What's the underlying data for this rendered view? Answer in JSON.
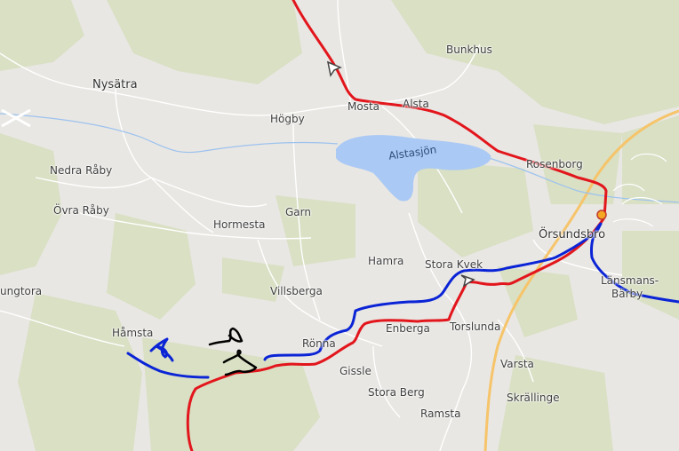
{
  "map": {
    "colors": {
      "background": "#e9e7e3",
      "forest": "#d3deba",
      "water": "#aac9f4",
      "stream": "#9cc2ef",
      "road_minor": "#ffffff",
      "road_major": "#f6c46a",
      "route_red": "#e2161c",
      "route_blue": "#0a24d6",
      "route_black": "#000000"
    },
    "labels": {
      "nysatra": "Nysätra",
      "hogby": "Högby",
      "mosta": "Mosta",
      "alsta": "Alsta",
      "bunkhus": "Bunkhus",
      "alstasjon": "Alstasjön",
      "rosenborg": "Rosenborg",
      "nedra_raby": "Nedra Råby",
      "ovra_raby": "Övra Råby",
      "hormesta": "Hormesta",
      "garn": "Garn",
      "orsundsbro": "Örsundsbro",
      "hamra": "Hamra",
      "stora_kvek": "Stora Kvek",
      "tungtora": "ungtora",
      "villsberga": "Villsberga",
      "lansmans_barby_1": "Länsmans-",
      "lansmans_barby_2": "Bärby",
      "hamsta": "Håmsta",
      "ronna": "Rönna",
      "enberga": "Enberga",
      "torslunda": "Torslunda",
      "gissle": "Gissle",
      "varsta": "Varsta",
      "stora_berg": "Stora Berg",
      "skrallinge": "Skrällinge",
      "ramsta": "Ramsta"
    }
  }
}
